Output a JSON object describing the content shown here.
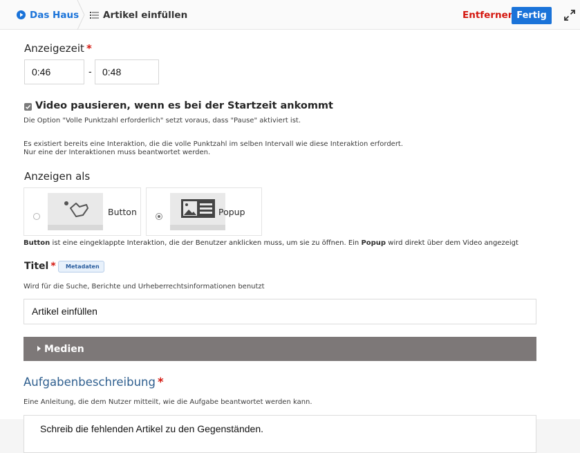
{
  "toolbar": {
    "home_label": "Das Haus",
    "current_label": "Artikel einfüllen",
    "remove_label": "Entfernen",
    "done_label": "Fertig",
    "home_icon": "play-circle-icon",
    "current_icon": "list-icon",
    "expand_icon": "expand-icon"
  },
  "display_time": {
    "label": "Anzeigezeit",
    "required_mark": "*",
    "start_value": "0:46",
    "separator": "-",
    "end_value": "0:48"
  },
  "pause": {
    "checked": true,
    "label": "Video pausieren, wenn es bei der Startzeit ankommt",
    "note": "Die Option \"Volle Punktzahl erforderlich\" setzt voraus, dass \"Pause\" aktiviert ist.",
    "info_line1": "Es existiert bereits eine Interaktion, die die volle Punktzahl im selben Intervall wie diese Interaktion erfordert.",
    "info_line2": "Nur eine der Interaktionen muss beantwortet werden."
  },
  "display_as": {
    "label": "Anzeigen als",
    "options": [
      {
        "label": "Button",
        "selected": false,
        "icon": "tap-icon"
      },
      {
        "label": "Popup",
        "selected": true,
        "icon": "popup-image-icon"
      }
    ],
    "desc_button": "Button",
    "desc_middle": " ist eine eingeklappte Interaktion, die der Benutzer anklicken muss, um sie zu öffnen. Ein ",
    "desc_popup": "Popup",
    "desc_end": " wird direkt über dem Video angezeigt"
  },
  "title_field": {
    "label": "Titel",
    "required_mark": "*",
    "badge": "Metadaten",
    "help": "Wird für die Suche, Berichte und Urheberrechtsinformationen benutzt",
    "value": "Artikel einfüllen"
  },
  "media": {
    "label": "Medien",
    "expanded": false
  },
  "task": {
    "heading": "Aufgabenbeschreibung",
    "required_mark": "*",
    "help": "Eine Anleitung, die dem Nutzer mitteilt, wie die Aufgabe beantwortet werden kann.",
    "value": "Schreib die fehlenden Artikel zu den Gegenständen."
  },
  "colors": {
    "accent": "#1a73d9",
    "danger": "#d4170f",
    "heading": "#2f5f8f",
    "media_bar": "#7d7878"
  }
}
